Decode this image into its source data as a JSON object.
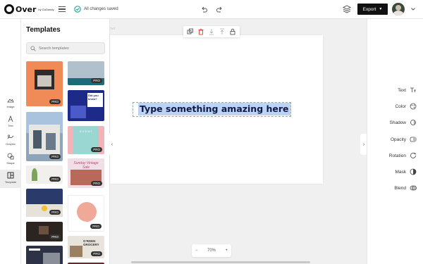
{
  "brand": {
    "name": "Over",
    "byline": "by GoDaddy"
  },
  "header": {
    "save_status": "All changes saved",
    "export_label": "Export"
  },
  "tools": [
    {
      "label": "Image",
      "icon": "image-icon"
    },
    {
      "label": "Text",
      "icon": "text-icon"
    },
    {
      "label": "Graphic",
      "icon": "graphic-icon"
    },
    {
      "label": "Shape",
      "icon": "shape-icon"
    },
    {
      "label": "Template",
      "icon": "template-icon",
      "active": true
    }
  ],
  "templates_panel": {
    "title": "Templates",
    "search_placeholder": "Search templates",
    "badge": "PRO",
    "items": [
      {
        "name": "orange-photo-template",
        "text": ""
      },
      {
        "name": "blue-shelves-template",
        "text": ""
      },
      {
        "name": "building-sky-template",
        "text": ""
      },
      {
        "name": "did-you-know-template",
        "text": "Did you know?"
      },
      {
        "name": "pink-poster-template",
        "text": "E V E N T"
      },
      {
        "name": "plant-template",
        "text": ""
      },
      {
        "name": "cursive-pink-template",
        "text": "Sunday Vintage Sale"
      },
      {
        "name": "blue-wall-template",
        "text": ""
      },
      {
        "name": "circle-logo-template",
        "text": ""
      },
      {
        "name": "dark-gadget-template",
        "text": ""
      },
      {
        "name": "cafe-template",
        "text": ""
      },
      {
        "name": "garden-grocery-template",
        "text": "G'RDEN GROCERY"
      },
      {
        "name": "city-template",
        "text": ""
      },
      {
        "name": "maroon-template",
        "text": ""
      }
    ]
  },
  "canvas": {
    "artboard_label": "TXT",
    "text": "Type something amazing here",
    "zoom": "70%",
    "zoom_out": "−",
    "zoom_in": "+"
  },
  "properties": [
    {
      "label": "Text",
      "icon": "text-format-icon"
    },
    {
      "label": "Color",
      "icon": "palette-icon"
    },
    {
      "label": "Shadow",
      "icon": "shadow-icon"
    },
    {
      "label": "Opacity",
      "icon": "opacity-icon"
    },
    {
      "label": "Rotation",
      "icon": "rotation-icon"
    },
    {
      "label": "Mask",
      "icon": "mask-icon"
    },
    {
      "label": "Blend",
      "icon": "blend-icon"
    }
  ],
  "colors": {
    "accent_check": "#2aa7a0",
    "selection": "#bcd3f3",
    "text_dark": "#0d1a4a",
    "delete_red": "#e0413a",
    "export_bg": "#111111"
  }
}
